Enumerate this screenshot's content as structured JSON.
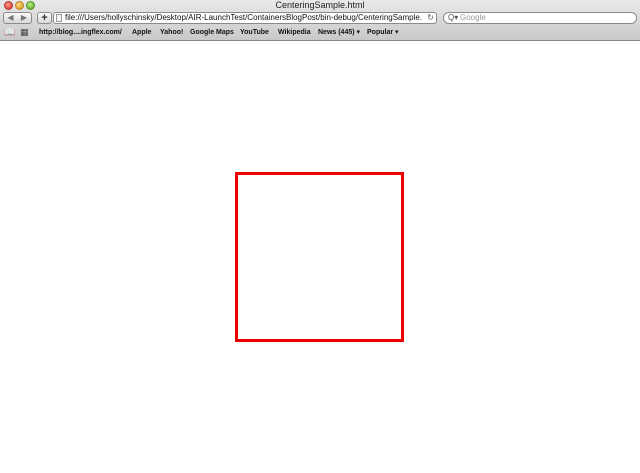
{
  "window": {
    "title": "CenteringSample.html"
  },
  "toolbar": {
    "back_icon": "◀",
    "forward_icon": "▶",
    "add_icon": "+",
    "url": "file:///Users/hollyschinsky/Desktop/AIR-LaunchTest/ContainersBlogPost/bin-debug/CenteringSample.html",
    "reload_icon": "↻",
    "search_icon": "Q▾",
    "search_placeholder": "Google"
  },
  "bookmarks": {
    "book_icon": "📖",
    "grid_icon": "▦",
    "items": [
      "http://blog....ingflex.com/",
      "Apple",
      "Yahoo!",
      "Google Maps",
      "YouTube",
      "Wikipedia",
      "News (445) ▾",
      "Popular ▾"
    ]
  },
  "page": {
    "box_color": "#ee0000"
  }
}
